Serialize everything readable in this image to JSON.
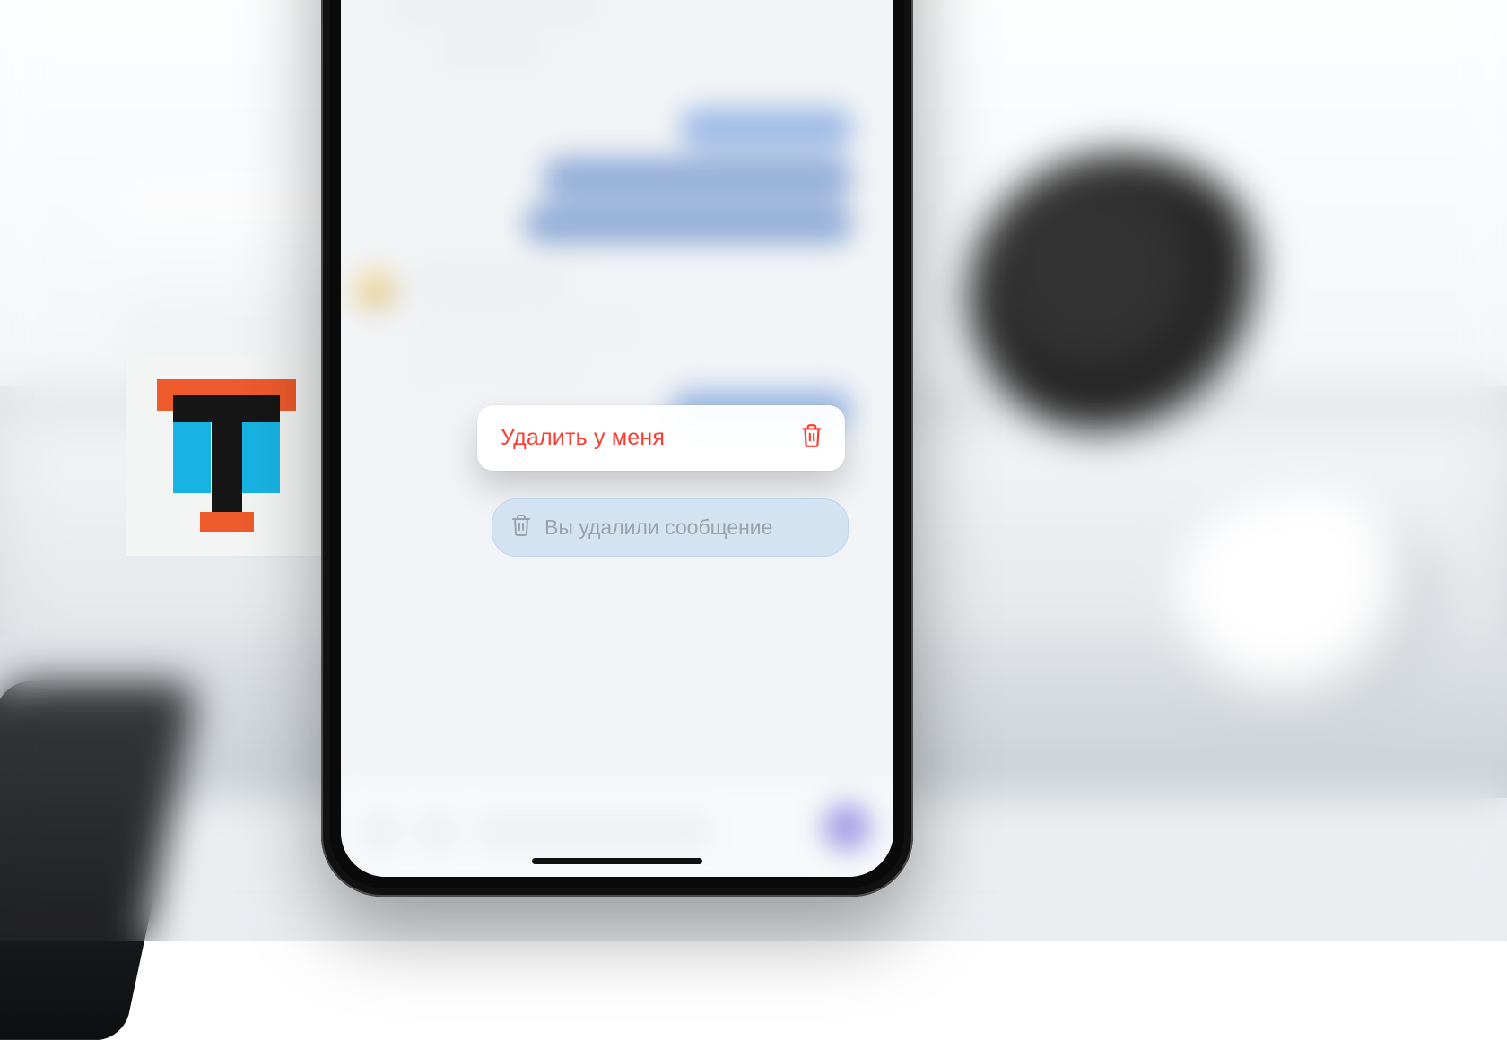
{
  "context_menu": {
    "delete_label": "Удалить у меня",
    "delete_icon": "trash-icon"
  },
  "deleted_message": {
    "text": "Вы удалили сообщение",
    "icon": "trash-icon"
  },
  "colors": {
    "destructive": "#ff3b30",
    "muted_text": "#9aa2ab",
    "deleted_bubble_bg": "#d4e3f2"
  },
  "logo": {
    "letter": "T",
    "colors": {
      "top": "#ee5b2c",
      "sides": "#18b3e3",
      "stem": "#161616"
    }
  }
}
